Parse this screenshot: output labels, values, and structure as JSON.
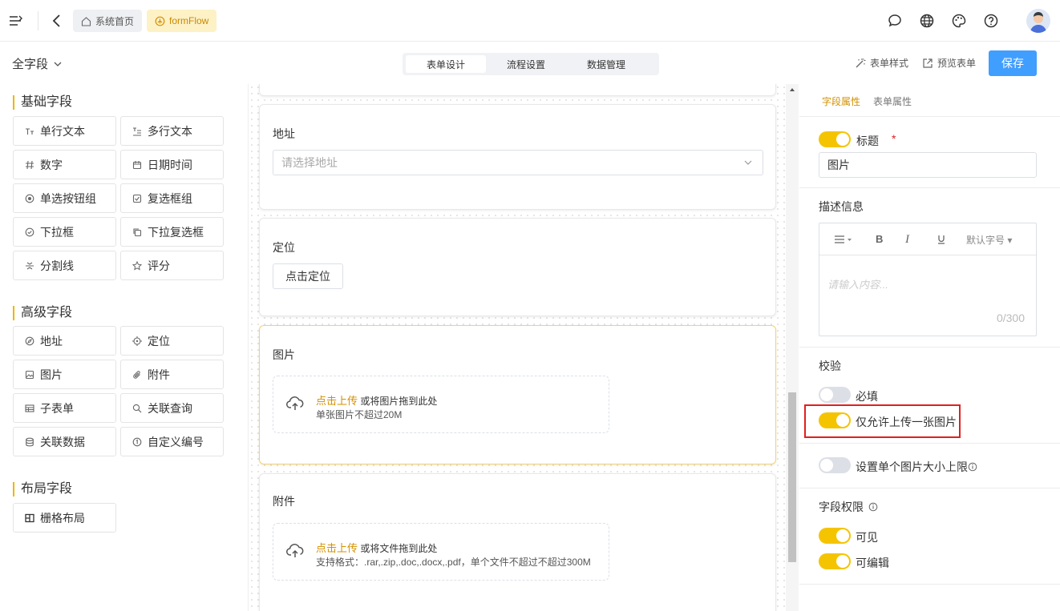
{
  "topbar": {
    "breadcrumbs": [
      "系统首页",
      "formFlow"
    ]
  },
  "subbar": {
    "all_fields": "全字段",
    "tabs": [
      "表单设计",
      "流程设置",
      "数据管理"
    ],
    "form_style": "表单样式",
    "preview": "预览表单",
    "save": "保存"
  },
  "left": {
    "basic_title": "基础字段",
    "basic_items": [
      "单行文本",
      "多行文本",
      "数字",
      "日期时间",
      "单选按钮组",
      "复选框组",
      "下拉框",
      "下拉复选框",
      "分割线",
      "评分"
    ],
    "advanced_title": "高级字段",
    "advanced_items": [
      "地址",
      "定位",
      "图片",
      "附件",
      "子表单",
      "关联查询",
      "关联数据",
      "自定义编号"
    ],
    "layout_title": "布局字段",
    "layout_items": [
      "栅格布局"
    ]
  },
  "canvas": {
    "address_label": "地址",
    "address_placeholder": "请选择地址",
    "location_label": "定位",
    "location_button": "点击定位",
    "image_label": "图片",
    "image_upload_link": "点击上传",
    "image_upload_text": " 或将图片拖到此处",
    "image_upload_hint": "单张图片不超过20M",
    "attachment_label": "附件",
    "attachment_upload_link": "点击上传",
    "attachment_upload_text": " 或将文件拖到此处",
    "attachment_upload_hint": "支持格式：.rar,.zip,.doc,.docx,.pdf，单个文件不超过不超过300M"
  },
  "right": {
    "tab_field": "字段属性",
    "tab_form": "表单属性",
    "title_label": "标题",
    "required_star": "*",
    "title_value": "图片",
    "desc_label": "描述信息",
    "editor_font": "默认字号",
    "editor_placeholder": "请输入内容...",
    "editor_count": "0/300",
    "validate_label": "校验",
    "required_label": "必填",
    "single_image_label": "仅允许上传一张图片",
    "size_limit_label": "设置单个图片大小上限",
    "perm_label": "字段权限",
    "visible_label": "可见",
    "editable_label": "可编辑"
  },
  "toggles": {
    "title": true,
    "required": false,
    "single_image": true,
    "size_limit": false,
    "visible": true,
    "editable": true
  },
  "colors": {
    "accent": "#f5c400",
    "primary": "#409eff",
    "highlight": "#e02020"
  }
}
